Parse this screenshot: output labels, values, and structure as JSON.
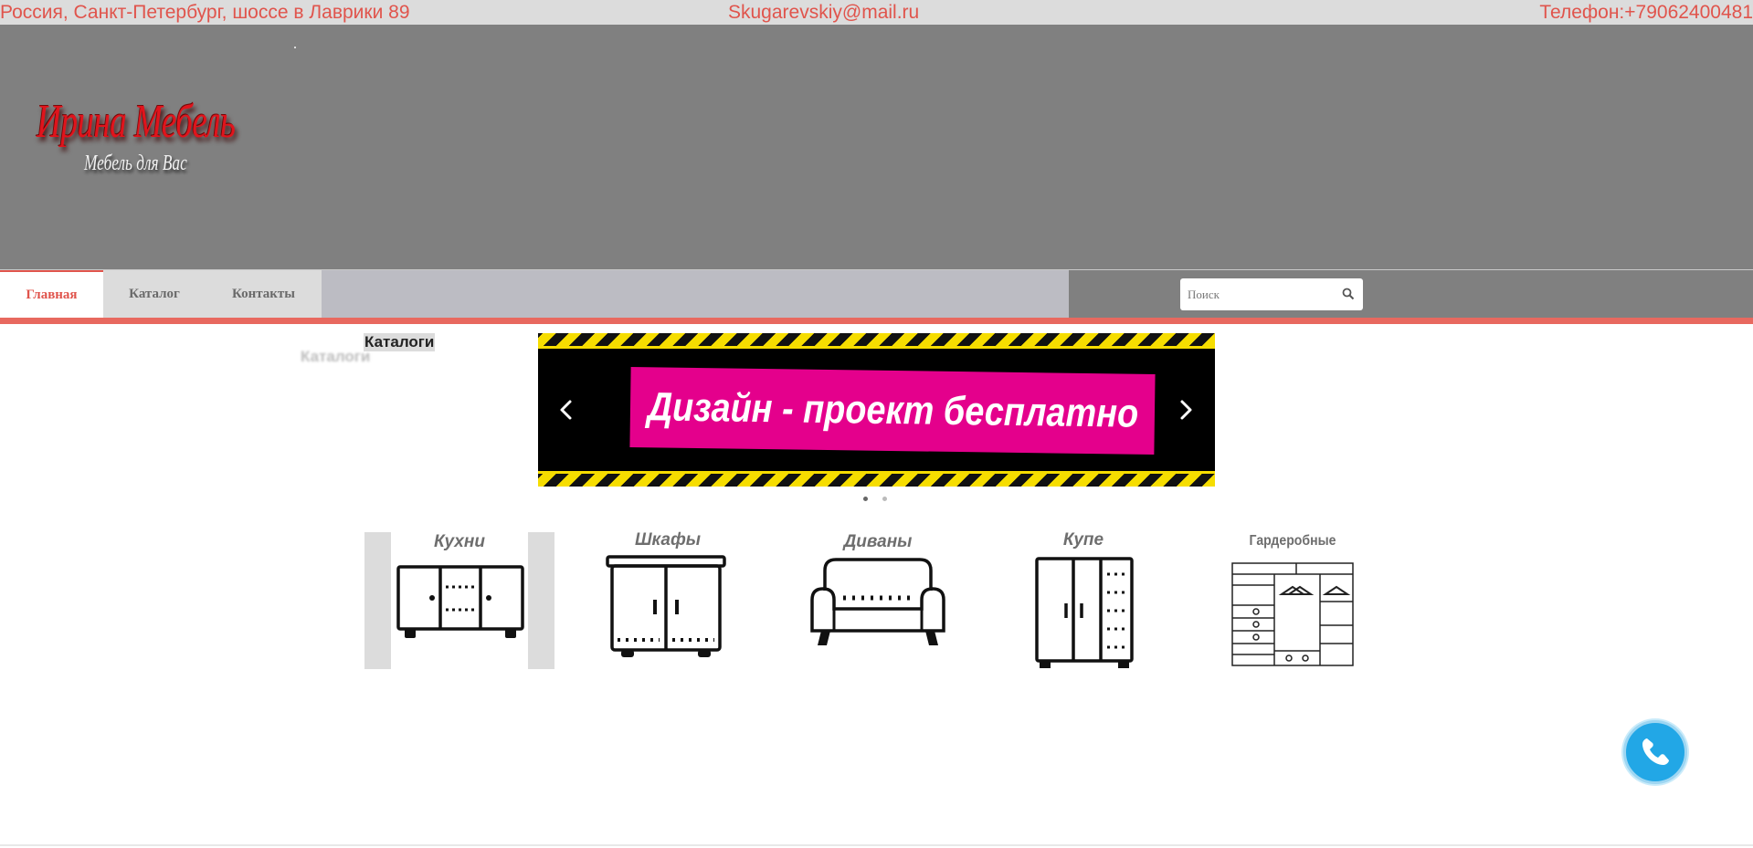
{
  "topbar": {
    "address": "Россия, Санкт-Петербург, шоссе в Лаврики 89",
    "email": "Skugarevskiy@mail.ru",
    "phone": "Телефон:+79062400481"
  },
  "logo": {
    "title": "Ирина Мебель",
    "subtitle": "Мебель для Вас"
  },
  "nav": {
    "items": [
      {
        "label": "Главная",
        "active": true
      },
      {
        "label": "Каталог",
        "active": false
      },
      {
        "label": "Контакты",
        "active": false
      }
    ]
  },
  "search": {
    "placeholder": "Поиск",
    "icon": "search-icon"
  },
  "catalog": {
    "heading": "Каталоги",
    "heading_shadow": "Каталоги"
  },
  "banner": {
    "text": "Дизайн - проект бесплатно",
    "slide_count": 2,
    "active_slide": 1,
    "prev_icon": "chevron-left-icon",
    "next_icon": "chevron-right-icon"
  },
  "categories": [
    {
      "label": "Кухни",
      "icon": "kitchen-cabinet-icon"
    },
    {
      "label": "Шкафы",
      "icon": "wardrobe-icon"
    },
    {
      "label": "Диваны",
      "icon": "sofa-icon"
    },
    {
      "label": "Купе",
      "icon": "sliding-wardrobe-icon"
    },
    {
      "label": "Гардеробные",
      "icon": "dressing-room-icon"
    }
  ],
  "call_button": {
    "icon": "phone-icon"
  },
  "colors": {
    "accent_red": "#e0544c",
    "header_gray": "#808080",
    "banner_pink": "#e4008c",
    "hazard_yellow": "#f6dd00",
    "call_blue": "#22a7e6"
  }
}
